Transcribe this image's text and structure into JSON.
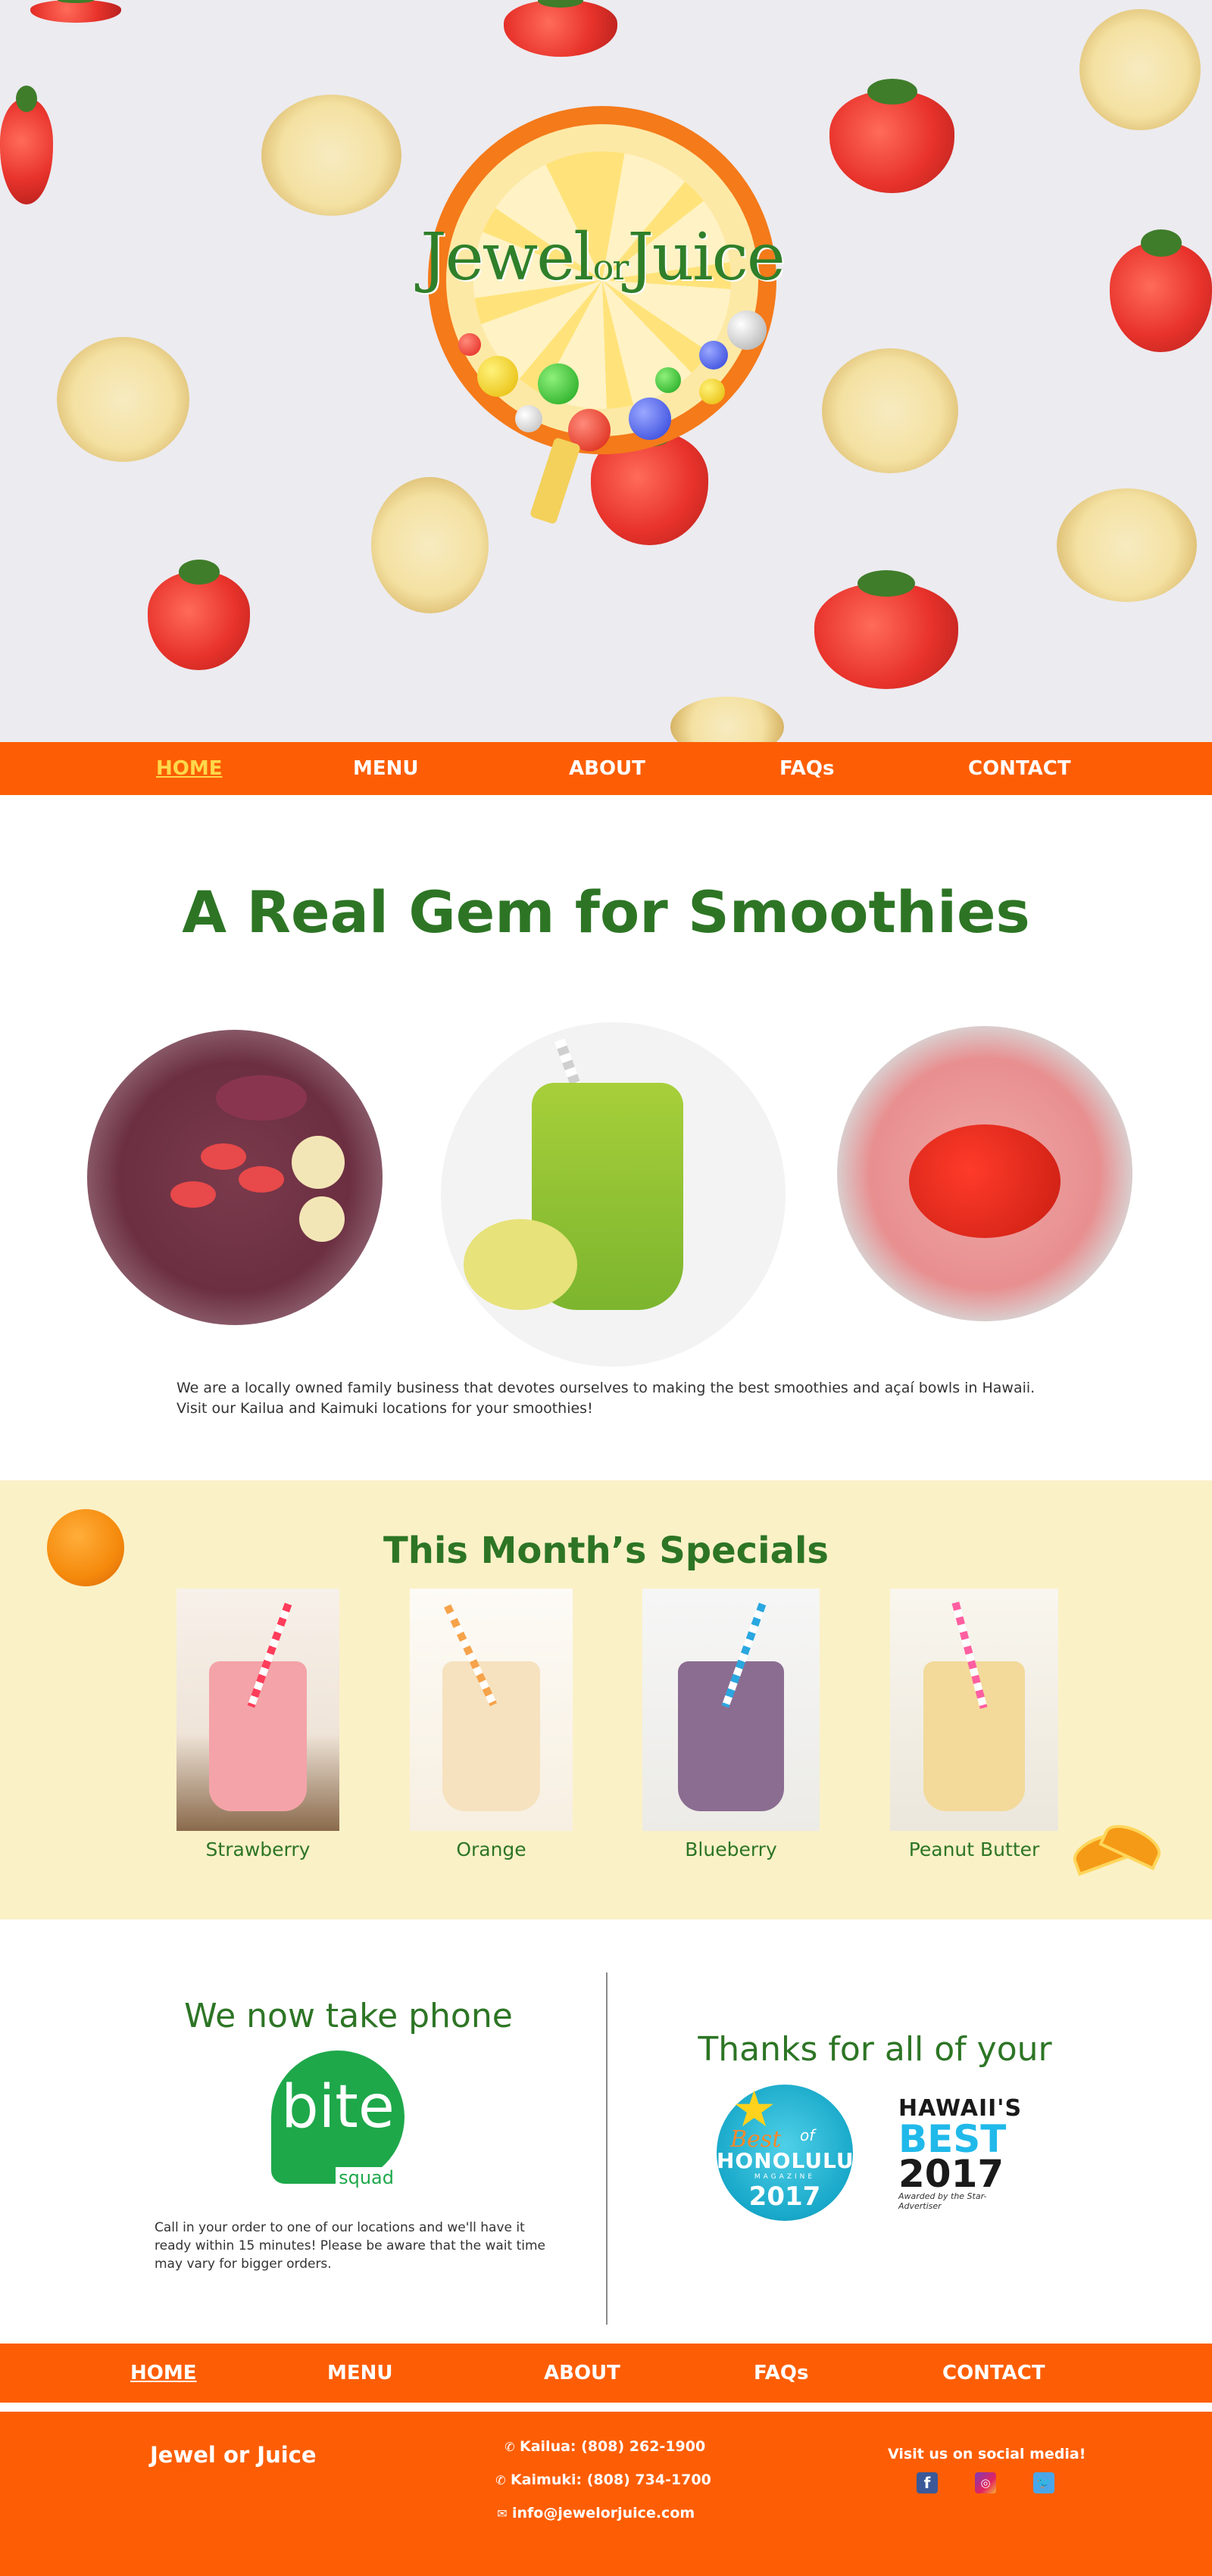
{
  "hero": {
    "logo": {
      "word1": "Jewel",
      "word2": "or",
      "word3": "Juice"
    }
  },
  "nav": {
    "items": [
      {
        "label": "HOME",
        "active": true
      },
      {
        "label": "MENU",
        "active": false
      },
      {
        "label": "ABOUT",
        "active": false
      },
      {
        "label": "FAQs",
        "active": false
      },
      {
        "label": "CONTACT",
        "active": false
      }
    ]
  },
  "intro": {
    "heading": "A Real Gem for Smoothies",
    "description": "We are a locally owned family business that devotes ourselves to making the best smoothies and açaí bowls in Hawaii. Visit our Kailua and Kaimuki locations for your smoothies!",
    "images": [
      "acai-bowl-image",
      "green-smoothie-image",
      "strawberry-smoothie-image"
    ]
  },
  "specials": {
    "heading": "This Month’s Specials",
    "items": [
      {
        "name": "Strawberry",
        "color": "#f4a3a8"
      },
      {
        "name": "Orange",
        "color": "#f6e2bf"
      },
      {
        "name": "Blueberry",
        "color": "#8b6d91"
      },
      {
        "name": "Peanut Butter",
        "color": "#f3da9a"
      }
    ]
  },
  "phone_orders": {
    "heading": "We now take phone",
    "partner_logo_word": "bite",
    "partner_logo_sub": "squad",
    "text": "Call in your order to one of our locations and we'll have it ready within 15 minutes! Please be aware that the wait time may vary for bigger orders."
  },
  "thanks": {
    "heading": "Thanks for all of your",
    "badge1": {
      "best": "Best",
      "of": "of",
      "city": "HONOLULU",
      "magazine": "MAGAZINE",
      "year": "2017"
    },
    "badge2": {
      "line1": "HAWAII'S",
      "line2": "BEST",
      "line3": "2017",
      "line4": "Awarded by the Star-Advertiser"
    }
  },
  "footer": {
    "brand": "Jewel or Juice",
    "kailua": "Kailua: (808) 262-1900",
    "kaimuki": "Kaimuki: (808) 734-1700",
    "email": "info@jewelorjuice.com",
    "social_title": "Visit us on social media!",
    "social": [
      "facebook-icon",
      "instagram-icon",
      "twitter-icon"
    ]
  },
  "colors": {
    "brand_orange": "#fd5e05",
    "brand_green": "#2d7525",
    "specials_bg": "#fbf1c7",
    "active_nav": "#ffd84a"
  }
}
